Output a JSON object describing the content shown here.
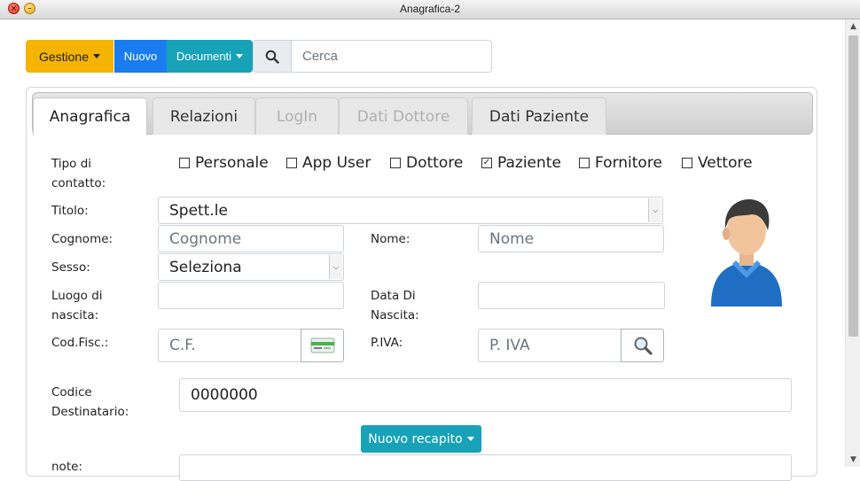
{
  "window": {
    "title": "Anagrafica-2",
    "close_glyph": "×",
    "minimize_glyph": "–"
  },
  "toolbar": {
    "gestione_label": "Gestione",
    "nuovo_label": "Nuovo",
    "documenti_label": "Documenti",
    "search_icon": "magnifier-icon",
    "search_placeholder": "Cerca",
    "colors": {
      "gestione": "#f4b400",
      "nuovo": "#1a7cf0",
      "documenti": "#17a2b8"
    }
  },
  "tabs": [
    {
      "label": "Anagrafica",
      "state": "active"
    },
    {
      "label": "Relazioni",
      "state": "normal"
    },
    {
      "label": "LogIn",
      "state": "disabled"
    },
    {
      "label": "Dati Dottore",
      "state": "disabled"
    },
    {
      "label": "Dati Paziente",
      "state": "normal"
    }
  ],
  "form": {
    "tipo_contatto_label": "Tipo di contatto:",
    "tipo_options": [
      {
        "label": "Personale",
        "checked": false
      },
      {
        "label": "App User",
        "checked": false
      },
      {
        "label": "Dottore",
        "checked": false
      },
      {
        "label": "Paziente",
        "checked": true
      },
      {
        "label": "Fornitore",
        "checked": false
      },
      {
        "label": "Vettore",
        "checked": false
      }
    ],
    "titolo_label": "Titolo:",
    "titolo_value": "Spett.le",
    "cognome_label": "Cognome:",
    "cognome_placeholder": "Cognome",
    "nome_label": "Nome:",
    "nome_placeholder": "Nome",
    "sesso_label": "Sesso:",
    "sesso_value": "Seleziona",
    "luogo_label": "Luogo di nascita:",
    "data_label": "Data Di Nascita:",
    "codfisc_label": "Cod.Fisc.:",
    "codfisc_placeholder": "C.F.",
    "piva_label": "P.IVA:",
    "piva_placeholder": "P. IVA",
    "codice_dest_label": "Codice Destinatario:",
    "codice_dest_value": "0000000",
    "nuovo_recapito_label": "Nuovo recapito",
    "note_label": "note:"
  },
  "scrollbar": {
    "up_glyph": "▲",
    "down_glyph": "▼"
  }
}
